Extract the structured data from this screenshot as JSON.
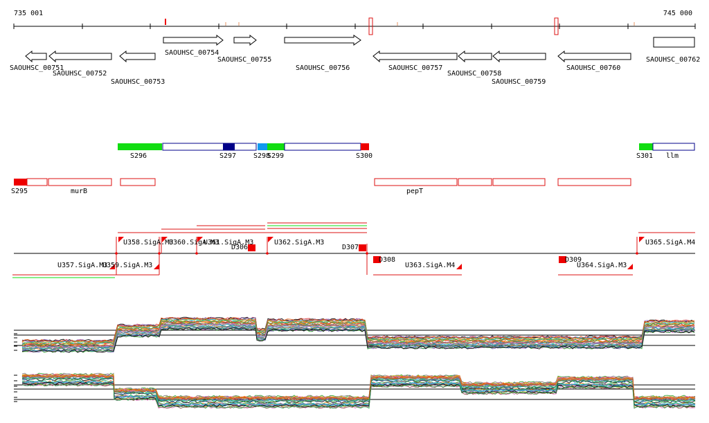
{
  "ruler": {
    "start_label": "735 001",
    "end_label": "745 000"
  },
  "colors": {
    "gene_outline": "#000000",
    "feature_outline": "#dd1111",
    "green": "#11dd11",
    "navy": "#000088",
    "blue": "#1199ee",
    "red": "#ee0000",
    "pale": "#f2c9b0"
  },
  "genes": [
    {
      "name": "SAOUHSC_00751",
      "strand": "-"
    },
    {
      "name": "SAOUHSC_00752",
      "strand": "-"
    },
    {
      "name": "SAOUHSC_00753",
      "strand": "-"
    },
    {
      "name": "SAOUHSC_00754",
      "strand": "+"
    },
    {
      "name": "SAOUHSC_00755",
      "strand": "+"
    },
    {
      "name": "SAOUHSC_00756",
      "strand": "+"
    },
    {
      "name": "SAOUHSC_00757",
      "strand": "-"
    },
    {
      "name": "SAOUHSC_00758",
      "strand": "-"
    },
    {
      "name": "SAOUHSC_00759",
      "strand": "-"
    },
    {
      "name": "SAOUHSC_00760",
      "strand": "-"
    },
    {
      "name": "SAOUHSC_00762",
      "strand": "none"
    }
  ],
  "segments_plus": [
    "S296",
    "S297",
    "S298",
    "S299",
    "S300",
    "S301",
    "llm"
  ],
  "segments_minus": [
    "S295",
    "murB",
    "pepT"
  ],
  "upshifts_top": [
    "U358.SigA.M3",
    "U360.SigA.M3",
    "U361.SigA.M3",
    "U362.SigA.M3",
    "U365.SigA.M4"
  ],
  "upshifts_bottom": [
    "U357.SigA.M3",
    "U359.SigA.M3",
    "U363.SigA.M4",
    "U364.SigA.M3"
  ],
  "downshifts": [
    "D306",
    "D307",
    "D308",
    "D309"
  ]
}
